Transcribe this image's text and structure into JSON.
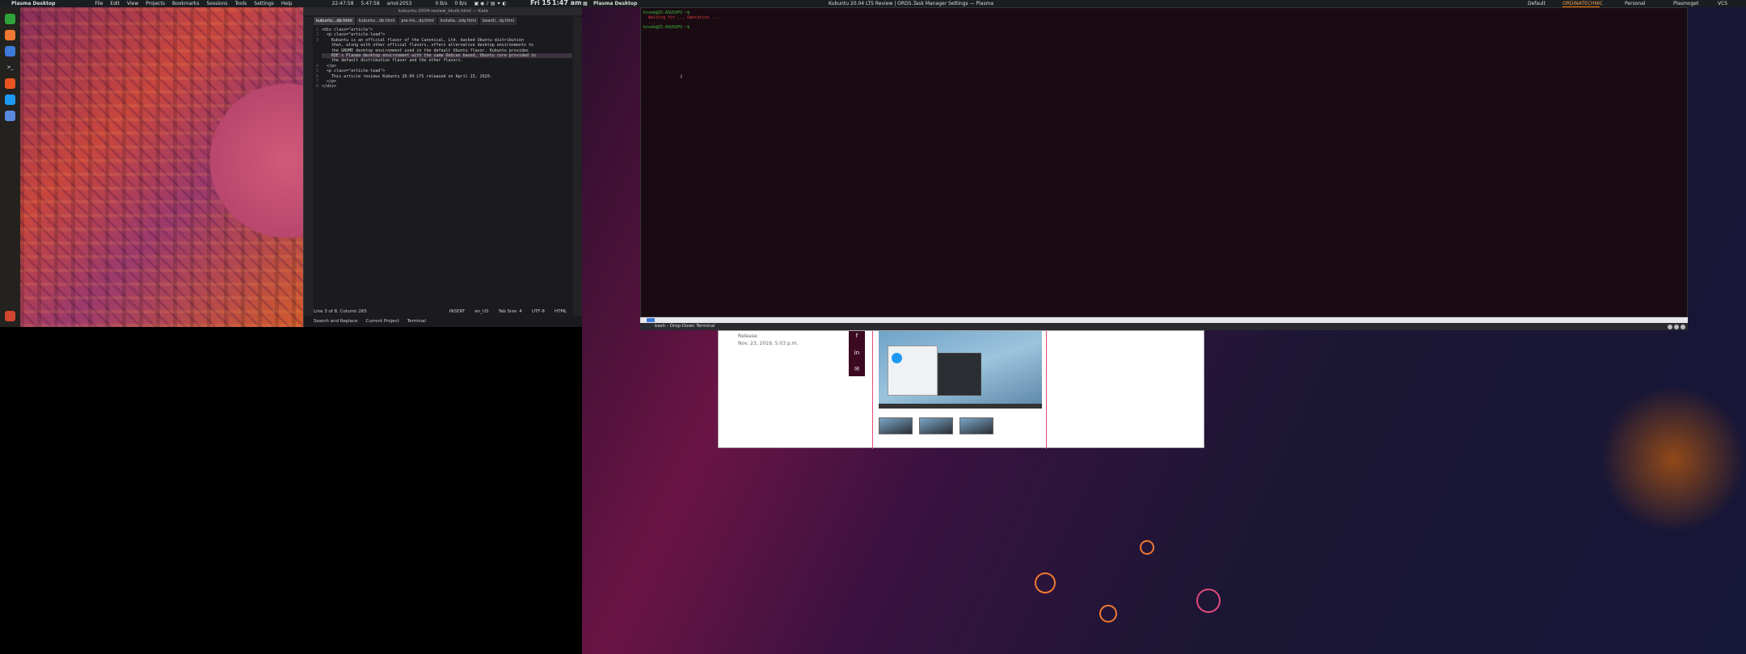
{
  "left_panel": {
    "app_title": "Plasma Desktop",
    "menu": [
      "File",
      "Edit",
      "View",
      "Projects",
      "Bookmarks",
      "Sessions",
      "Tools",
      "Settings",
      "Help"
    ],
    "clock_line1": "22:47:58",
    "clock_line2": "5:47:58",
    "clock_label": "amd-2053",
    "net_down": "0 B/s",
    "net_up": "0 B/s"
  },
  "right_panel": {
    "app_title": "Plasma Desktop",
    "datetime": "Fri 15",
    "time": "1:47 am",
    "tasks": [
      "Kubuntu 20.04 LTS Review | ORDS...",
      "Task Manager Settings — Plasma"
    ],
    "desktops": [
      "Default",
      "ORDINATECHNIC",
      "Personal",
      "Plasmoget",
      "VCS"
    ],
    "active_desktop": "ORDINATECHNIC"
  },
  "editor": {
    "title": "kubuntu-2004-review_blurb.html — Kate",
    "tabs": [
      "kubuntu...db.html",
      "kubuntu...db.html",
      "pre-ins...dy.html",
      "Installa...ody.html",
      "beardi...dy.html"
    ],
    "active_tab": 0,
    "side_left": "Documents",
    "side_right": "Projects",
    "code": [
      {
        "n": "1",
        "t": "<div class=\"article\">",
        "hl": false
      },
      {
        "n": "2",
        "t": "  <p class=\"article-lead\">",
        "hl": false
      },
      {
        "n": "3",
        "t": "    Kubuntu is an official flavor of the Canonical, Ltd. backed Ubuntu distribution",
        "hl": false
      },
      {
        "n": "",
        "t": "    that, along with other official flavors, offers alternative desktop environments to",
        "hl": false
      },
      {
        "n": "",
        "t": "    the GNOME desktop environment used in the default Ubuntu flavor. Kubuntu provides",
        "hl": false
      },
      {
        "n": "",
        "t": "    KDE's Plasma desktop environment with the same Debian based, Ubuntu core provided in",
        "hl": true
      },
      {
        "n": "",
        "t": "    the default distribution flavor and the other flavors.",
        "hl": false
      },
      {
        "n": "4",
        "t": "  </p>",
        "hl": false
      },
      {
        "n": "5",
        "t": "  <p class=\"article-lead\">",
        "hl": false
      },
      {
        "n": "6",
        "t": "    This article reviews Kubuntu 20.04 LTS released on April 23, 2020.",
        "hl": false
      },
      {
        "n": "7",
        "t": "  </p>",
        "hl": false
      },
      {
        "n": "8",
        "t": "</div>",
        "hl": false
      }
    ],
    "status": {
      "position": "Line 3 of 8, Column 265",
      "mode": "INSERT",
      "lang": "en_US",
      "tabs": "Tab Size: 4",
      "encoding": "UTF-8",
      "syntax": "HTML"
    },
    "bottom": [
      "Search and Replace",
      "Current Project",
      "Terminal"
    ]
  },
  "terminal": {
    "title": "bash - Drop-Down Terminal",
    "lines": [
      {
        "c": "g",
        "t": "brook@ZS-ASUSVPS ~$ "
      },
      {
        "c": "r",
        "t": "  Waiting for ... Operation ..."
      },
      {
        "c": "r",
        "t": "  ..."
      },
      {
        "c": "g",
        "t": "brook@ZS-ASUSVPS ~$ "
      }
    ]
  },
  "browser": {
    "release_label": "Release:",
    "release_date": "Nov. 23, 2019, 5:03 p.m."
  }
}
